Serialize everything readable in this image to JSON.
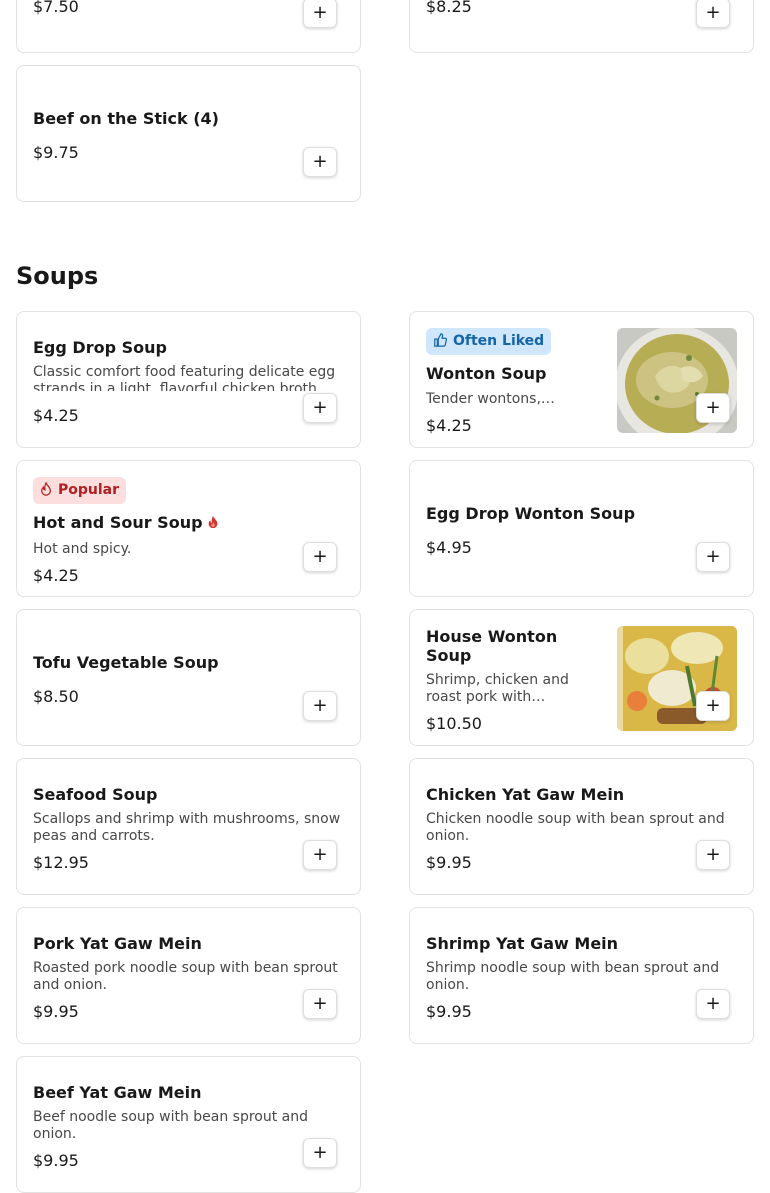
{
  "prev_items": [
    {
      "price": "$7.50"
    },
    {
      "price": "$8.25"
    },
    {
      "title": "Beef on the Stick (4)",
      "price": "$9.75"
    }
  ],
  "section": {
    "title": "Soups"
  },
  "badges": {
    "often_liked": "Often Liked",
    "popular": "Popular"
  },
  "items": [
    {
      "title": "Egg Drop Soup",
      "desc": "Classic comfort food featuring delicate egg strands in a light, flavorful chicken broth.",
      "price": "$4.25"
    },
    {
      "title": "Wonton Soup",
      "desc": "Tender wontons,…",
      "price": "$4.25",
      "badge": "Often Liked",
      "image": "wonton-soup-photo"
    },
    {
      "title": "Hot and Sour Soup",
      "desc": "Hot and spicy.",
      "price": "$4.25",
      "badge": "Popular",
      "spicy": true
    },
    {
      "title": "Egg Drop Wonton Soup",
      "price": "$4.95"
    },
    {
      "title": "Tofu Vegetable Soup",
      "price": "$8.50"
    },
    {
      "title": "House Wonton Soup",
      "desc": "Shrimp, chicken and roast pork with…",
      "price": "$10.50",
      "image": "house-wonton-soup-photo"
    },
    {
      "title": "Seafood Soup",
      "desc": "Scallops and shrimp with mushrooms, snow peas and carrots.",
      "price": "$12.95"
    },
    {
      "title": "Chicken Yat Gaw Mein",
      "desc": "Chicken noodle soup with bean sprout and onion.",
      "price": "$9.95"
    },
    {
      "title": "Pork Yat Gaw Mein",
      "desc": "Roasted pork noodle soup with bean sprout and onion.",
      "price": "$9.95"
    },
    {
      "title": "Shrimp Yat Gaw Mein",
      "desc": "Shrimp noodle soup with bean sprout and onion.",
      "price": "$9.95"
    },
    {
      "title": "Beef Yat Gaw Mein",
      "desc": "Beef noodle soup with bean sprout and onion.",
      "price": "$9.95"
    }
  ],
  "add_label": "+",
  "colors": {
    "often_liked_bg": "#cfe6fb",
    "often_liked_text": "#1466a8",
    "popular_bg": "#fcdede",
    "popular_text": "#b02020",
    "spicy_icon": "#d0342c"
  },
  "icons": {
    "add": "plus-icon",
    "often_liked": "thumbs-up-icon",
    "popular": "fire-icon",
    "spicy": "chili-flame-icon"
  }
}
